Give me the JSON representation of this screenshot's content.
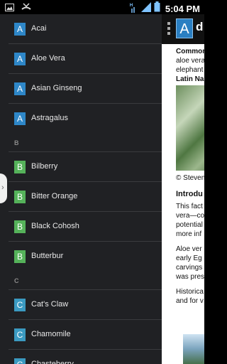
{
  "status_bar": {
    "time": "5:04",
    "time_suffix": "PM",
    "left_icons": [
      "image-icon",
      "missed-call-icon"
    ],
    "right_icons": [
      "hsdpa-signal-icon",
      "signal-bars-icon",
      "battery-icon"
    ]
  },
  "content": {
    "title_fragment": "d",
    "logo_letter": "A",
    "lines": [
      {
        "text": "Common",
        "bold": true
      },
      {
        "text": "aloe vera",
        "bold": false
      },
      {
        "text": "elephant",
        "bold": false
      },
      {
        "text": "Latin Na",
        "bold": true
      }
    ],
    "photo_credit": "© Steven",
    "intro_heading": "Introdu",
    "intro_lines": [
      "This fact",
      "vera—co",
      "potential",
      "more inf"
    ],
    "para2_lines": [
      "Aloe ver",
      "early Eg",
      "carvings",
      "was pres"
    ],
    "para3_lines": [
      "Historica",
      "and for v"
    ]
  },
  "drawer": {
    "items": [
      {
        "type": "item",
        "letter": "A",
        "color": "blue",
        "label": "Acai"
      },
      {
        "type": "item",
        "letter": "A",
        "color": "blue",
        "label": "Aloe Vera"
      },
      {
        "type": "item",
        "letter": "A",
        "color": "blue",
        "label": "Asian Ginseng"
      },
      {
        "type": "item",
        "letter": "A",
        "color": "blue",
        "label": "Astragalus"
      },
      {
        "type": "section",
        "letter": "B"
      },
      {
        "type": "item",
        "letter": "B",
        "color": "green",
        "label": "Bilberry"
      },
      {
        "type": "item",
        "letter": "B",
        "color": "green",
        "label": "Bitter Orange"
      },
      {
        "type": "item",
        "letter": "B",
        "color": "green",
        "label": "Black Cohosh"
      },
      {
        "type": "item",
        "letter": "B",
        "color": "green",
        "label": "Butterbur"
      },
      {
        "type": "section",
        "letter": "C"
      },
      {
        "type": "item",
        "letter": "C",
        "color": "teal",
        "label": "Cat's Claw"
      },
      {
        "type": "item",
        "letter": "C",
        "color": "teal",
        "label": "Chamomile"
      },
      {
        "type": "item",
        "letter": "C",
        "color": "teal",
        "label": "Chasteberry"
      }
    ]
  },
  "drawer_handle_glyph": "›"
}
